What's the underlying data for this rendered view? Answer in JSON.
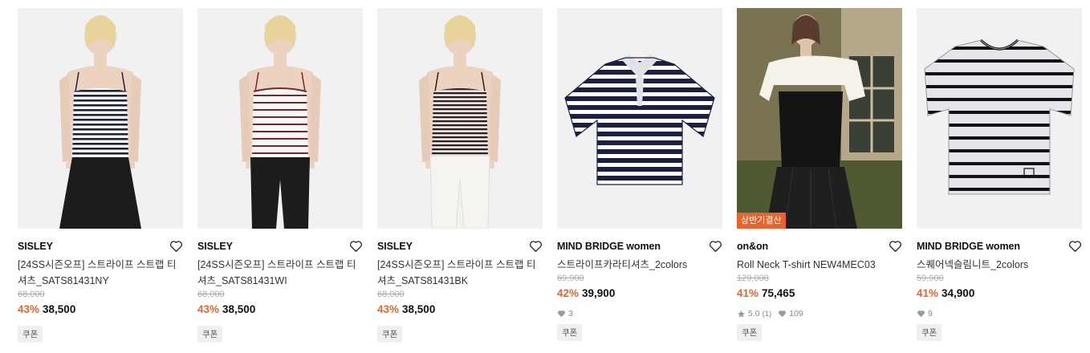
{
  "colors": {
    "discount": "#e8642c",
    "badge_bg": "#e8642c"
  },
  "products": [
    {
      "brand": "SISLEY",
      "title": "[24SS시즌오프] 스트라이프 스트랩 티셔츠_SATS81431NY",
      "original_price": "68,000",
      "discount": "43%",
      "price": "38,500",
      "coupon": "쿠폰",
      "icon": "heart-outline-icon"
    },
    {
      "brand": "SISLEY",
      "title": "[24SS시즌오프] 스트라이프 스트랩 티셔츠_SATS81431WI",
      "original_price": "68,000",
      "discount": "43%",
      "price": "38,500",
      "coupon": "쿠폰",
      "icon": "heart-outline-icon"
    },
    {
      "brand": "SISLEY",
      "title": "[24SS시즌오프] 스트라이프 스트랩 티셔츠_SATS81431BK",
      "original_price": "68,000",
      "discount": "43%",
      "price": "38,500",
      "coupon": "쿠폰",
      "icon": "heart-outline-icon"
    },
    {
      "brand": "MIND BRIDGE women",
      "title": "스트라이프카라티셔츠_2colors",
      "original_price": "69,900",
      "discount": "42%",
      "price": "39,900",
      "likes": "3",
      "coupon": "쿠폰",
      "icon": "heart-outline-icon"
    },
    {
      "brand": "on&on",
      "title": "Roll Neck T-shirt NEW4MEC03",
      "original_price": "129,000",
      "discount": "41%",
      "price": "75,465",
      "rating": "5.0",
      "review_count": "(1)",
      "likes": "109",
      "coupon": "쿠폰",
      "badge": "상반기결산",
      "icon": "heart-outline-icon"
    },
    {
      "brand": "MIND BRIDGE women",
      "title": "스퀘어넥슬림니트_2colors",
      "original_price": "59,900",
      "discount": "41%",
      "price": "34,900",
      "likes": "9",
      "coupon": "쿠폰",
      "icon": "heart-outline-icon"
    }
  ]
}
